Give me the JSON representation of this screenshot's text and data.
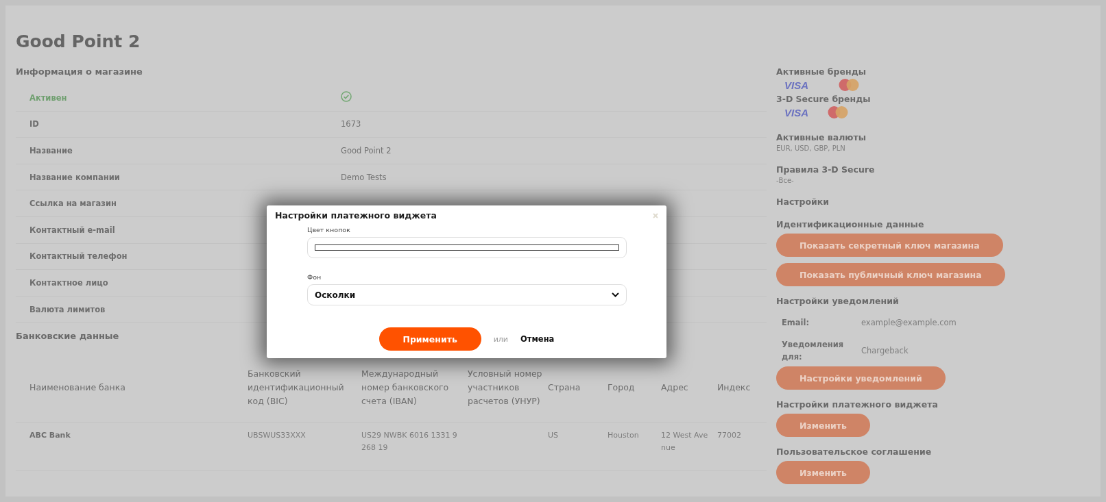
{
  "page_title": "Good Point 2",
  "store_info": {
    "heading": "Информация о магазине",
    "rows": [
      {
        "kind": "status",
        "label": "Активен",
        "active": true
      },
      {
        "kind": "field",
        "label": "ID",
        "value": "1673"
      },
      {
        "kind": "field",
        "label": "Название",
        "value": "Good Point 2"
      },
      {
        "kind": "field",
        "label": "Название компании",
        "value": "Demo Tests"
      },
      {
        "kind": "field",
        "label": "Ссылка на магазин"
      },
      {
        "kind": "field",
        "label": "Контактный e-mail"
      },
      {
        "kind": "field",
        "label": "Контактный телефон"
      },
      {
        "kind": "field",
        "label": "Контактное лицо"
      },
      {
        "kind": "field",
        "label": "Валюта лимитов"
      }
    ]
  },
  "bank": {
    "heading": "Банковские данные",
    "columns": [
      "Наименование банка",
      "Банковский идентификационный код (BIC)",
      "Международный номер банковского счета (IBAN)",
      "Условный номер участников расчетов (УНУР)",
      "Страна",
      "Город",
      "Адрес",
      "Индекс"
    ],
    "rows": [
      {
        "cells": [
          "ABC Bank",
          "UBSWUS33XXX",
          "US29 NWBK 6016 1331 9268 19",
          "",
          "US",
          "Houston",
          "12 West Avenue",
          "77002"
        ]
      }
    ]
  },
  "sidebar": [
    {
      "kind": "brands",
      "heading": "Активные бренды",
      "brands": [
        {
          "kind": "visa",
          "label": "VISA"
        },
        {
          "kind": "mastercard"
        }
      ]
    },
    {
      "kind": "brands",
      "heading": "3-D Secure бренды",
      "brands": [
        {
          "kind": "visa",
          "label": "VISA"
        },
        {
          "kind": "mastercard"
        }
      ]
    },
    {
      "kind": "text",
      "heading": "Активные валюты",
      "value": "EUR, USD, GBP, PLN"
    },
    {
      "kind": "text",
      "heading": "Правила 3-D Secure",
      "value": "-Все-"
    },
    {
      "kind": "heading",
      "heading": "Настройки"
    },
    {
      "kind": "buttons",
      "heading": "Идентификационные данные",
      "buttons": [
        "Показать секретный ключ магазина",
        "Показать публичный ключ магазина"
      ]
    },
    {
      "kind": "notifications",
      "heading": "Настройки уведомлений",
      "rows": [
        {
          "label": "Email:",
          "value": "example@example.com"
        },
        {
          "label": "Уведомления для:",
          "value": "Chargeback"
        }
      ],
      "buttons": [
        "Настройки уведомлений"
      ]
    },
    {
      "kind": "buttons",
      "heading": "Настройки платежного виджета",
      "buttons": [
        "Изменить"
      ]
    },
    {
      "kind": "buttons",
      "heading": "Пользовательское соглашение",
      "buttons": [
        "Изменить"
      ]
    }
  ],
  "modal": {
    "title": "Настройки платежного виджета",
    "fields": [
      {
        "kind": "color",
        "label": "Цвет кнопок",
        "color": "#ffffff"
      },
      {
        "kind": "select",
        "label": "Фон",
        "value": "Осколки"
      }
    ],
    "apply": "Применить",
    "separator": "или",
    "cancel": "Отмена"
  }
}
